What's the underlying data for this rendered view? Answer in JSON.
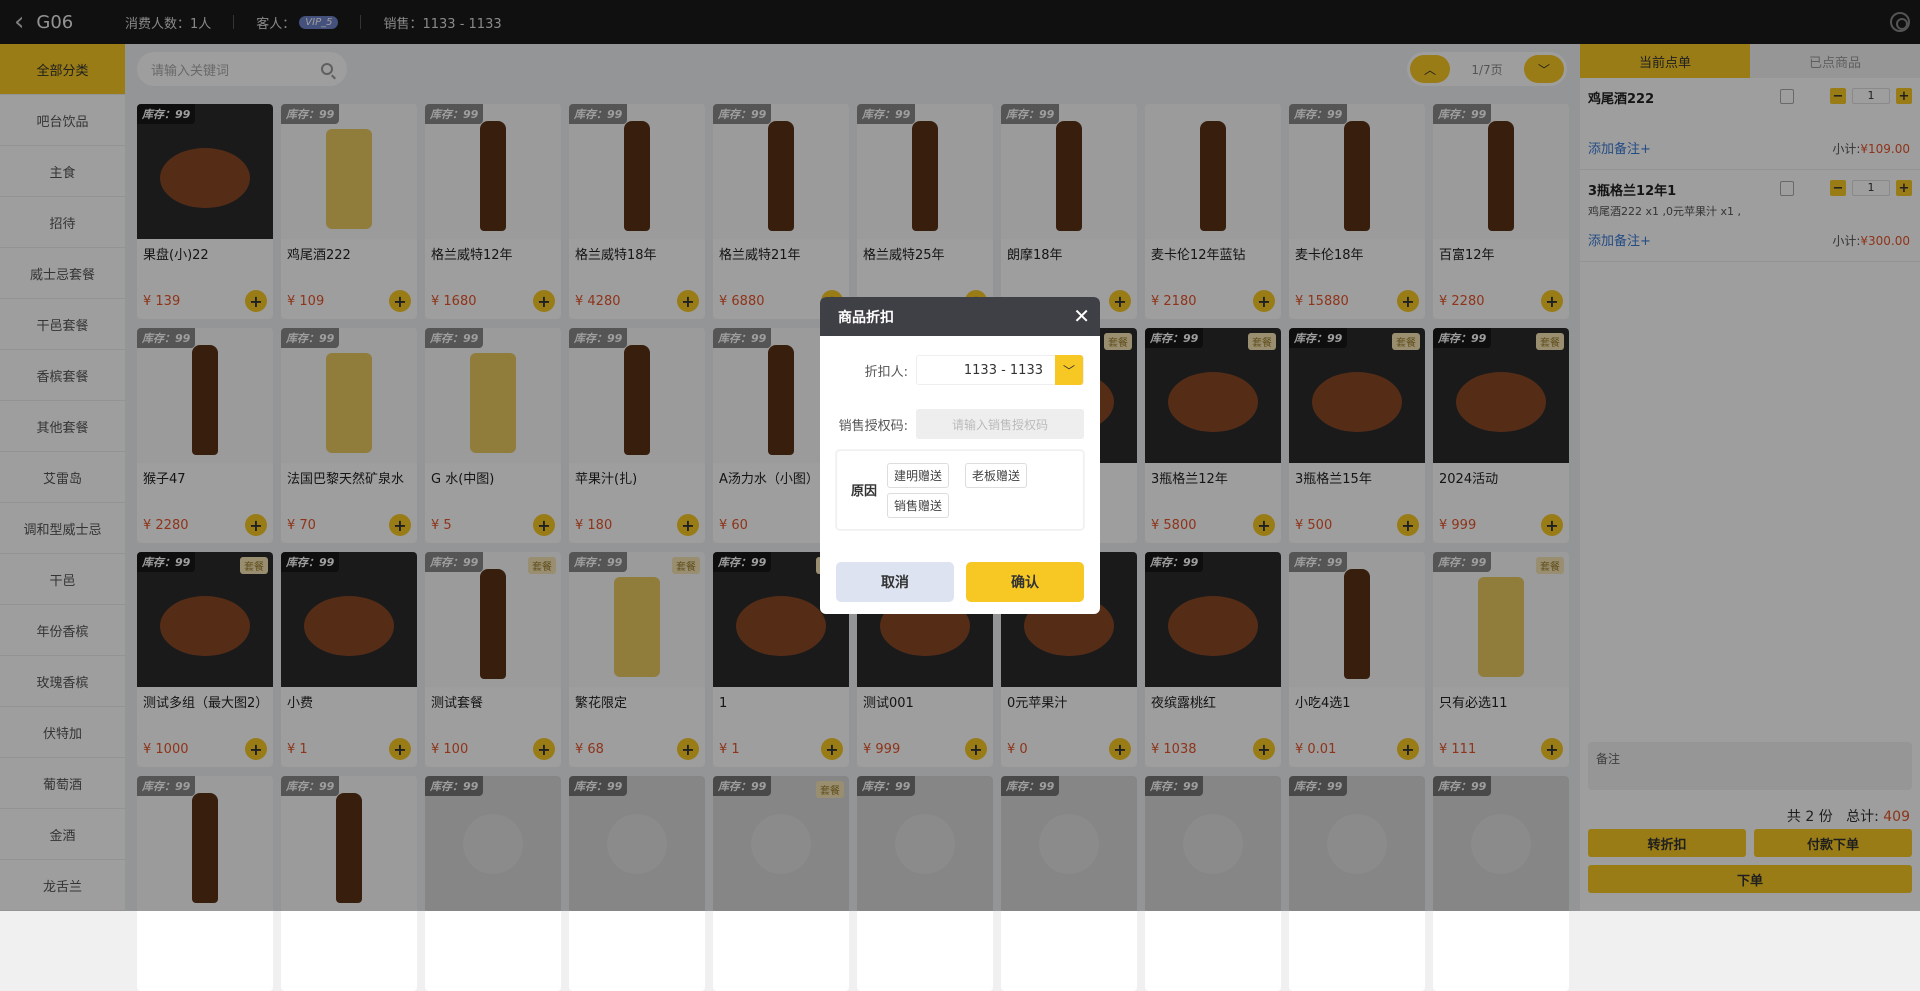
{
  "topbar": {
    "table": "G06",
    "people": "消费人数：1人",
    "guest_label": "客人：",
    "vip": "VIP_5",
    "sales": "销售：1133 - 1133"
  },
  "sidebar": {
    "items": [
      "全部分类",
      "吧台饮品",
      "主食",
      "招待",
      "威士忌套餐",
      "干邑套餐",
      "香槟套餐",
      "其他套餐",
      "艾雷岛",
      "调和型威士忌",
      "干邑",
      "年份香槟",
      "玫瑰香槟",
      "伏特加",
      "葡萄酒",
      "金酒",
      "龙舌兰"
    ]
  },
  "search": {
    "placeholder": "请输入关键词"
  },
  "pager": {
    "page": "1/7页"
  },
  "products": [
    {
      "stock": "库存：99",
      "name": "果盘(小)22",
      "price": "¥ 139",
      "combo": ""
    },
    {
      "stock": "库存：99",
      "name": "鸡尾酒222",
      "price": "¥ 109",
      "combo": ""
    },
    {
      "stock": "库存：99",
      "name": "格兰威特12年",
      "price": "¥ 1680",
      "combo": ""
    },
    {
      "stock": "库存：99",
      "name": "格兰威特18年",
      "price": "¥ 4280",
      "combo": ""
    },
    {
      "stock": "库存：99",
      "name": "格兰威特21年",
      "price": "¥ 6880",
      "combo": ""
    },
    {
      "stock": "库存：99",
      "name": "格兰威特25年",
      "price": "",
      "combo": ""
    },
    {
      "stock": "库存：99",
      "name": "朗摩18年",
      "price": "",
      "combo": ""
    },
    {
      "stock": "",
      "name": "麦卡伦12年蓝钻",
      "price": "¥ 2180",
      "combo": ""
    },
    {
      "stock": "库存：99",
      "name": "麦卡伦18年",
      "price": "¥ 15880",
      "combo": ""
    },
    {
      "stock": "库存：99",
      "name": "百富12年",
      "price": "¥ 2280",
      "combo": ""
    },
    {
      "stock": "库存：99",
      "name": "猴子47",
      "price": "¥ 2280",
      "combo": ""
    },
    {
      "stock": "库存：99",
      "name": "法国巴黎天然矿泉水",
      "price": "¥ 70",
      "combo": ""
    },
    {
      "stock": "库存：99",
      "name": "G 水(中图)",
      "price": "¥ 5",
      "combo": ""
    },
    {
      "stock": "库存：99",
      "name": "苹果汁(扎)",
      "price": "¥ 180",
      "combo": ""
    },
    {
      "stock": "库存：99",
      "name": "A汤力水（小图）",
      "price": "¥ 60",
      "combo": ""
    },
    {
      "stock": "",
      "name": "",
      "price": "",
      "combo": ""
    },
    {
      "stock": "",
      "name": "",
      "price": "",
      "combo": "套餐"
    },
    {
      "stock": "库存：99",
      "name": "3瓶格兰12年",
      "price": "¥ 5800",
      "combo": "套餐"
    },
    {
      "stock": "库存：99",
      "name": "3瓶格兰15年",
      "price": "¥ 500",
      "combo": "套餐"
    },
    {
      "stock": "库存：99",
      "name": "2024活动",
      "price": "¥ 999",
      "combo": "套餐"
    },
    {
      "stock": "库存：99",
      "name": "测试多组（最大图2）",
      "price": "¥ 1000",
      "combo": "套餐"
    },
    {
      "stock": "库存：99",
      "name": "小费",
      "price": "¥ 1",
      "combo": ""
    },
    {
      "stock": "库存：99",
      "name": "测试套餐",
      "price": "¥ 100",
      "combo": "套餐"
    },
    {
      "stock": "库存：99",
      "name": "繁花限定",
      "price": "¥ 68",
      "combo": "套餐"
    },
    {
      "stock": "库存：99",
      "name": "1",
      "price": "¥ 1",
      "combo": "套餐"
    },
    {
      "stock": "",
      "name": "测试001",
      "price": "¥ 999",
      "combo": ""
    },
    {
      "stock": "",
      "name": "0元苹果汁",
      "price": "¥ 0",
      "combo": ""
    },
    {
      "stock": "库存：99",
      "name": "夜缤露桃红",
      "price": "¥ 1038",
      "combo": ""
    },
    {
      "stock": "库存：99",
      "name": "小吃4选1",
      "price": "¥ 0.01",
      "combo": ""
    },
    {
      "stock": "库存：99",
      "name": "只有必选11",
      "price": "¥ 111",
      "combo": "套餐"
    },
    {
      "stock": "库存：99",
      "name": "",
      "price": "",
      "combo": ""
    },
    {
      "stock": "库存：99",
      "name": "",
      "price": "",
      "combo": ""
    },
    {
      "stock": "库存：99",
      "name": "",
      "price": "",
      "combo": ""
    },
    {
      "stock": "库存：99",
      "name": "",
      "price": "",
      "combo": ""
    },
    {
      "stock": "库存：99",
      "name": "",
      "price": "",
      "combo": "套餐"
    },
    {
      "stock": "库存：99",
      "name": "",
      "price": "",
      "combo": ""
    },
    {
      "stock": "库存：99",
      "name": "",
      "price": "",
      "combo": ""
    },
    {
      "stock": "库存：99",
      "name": "",
      "price": "",
      "combo": ""
    },
    {
      "stock": "库存：99",
      "name": "",
      "price": "",
      "combo": ""
    },
    {
      "stock": "库存：99",
      "name": "",
      "price": "",
      "combo": ""
    }
  ],
  "right": {
    "tab_current": "当前点单",
    "tab_done": "已点商品",
    "orders": [
      {
        "name": "鸡尾酒222",
        "desc": "",
        "qty": "1",
        "note": "添加备注+",
        "subtotal_label": "小计:",
        "subtotal": "¥109.00"
      },
      {
        "name": "3瓶格兰12年1",
        "desc": "鸡尾酒222 x1 ,0元苹果汁 x1 ,",
        "qty": "1",
        "note": "添加备注+",
        "subtotal_label": "小计:",
        "subtotal": "¥300.00"
      }
    ],
    "remark": "备注",
    "count": "共 2 份",
    "total_label": "总计:",
    "total": "409",
    "btn_discount": "转折扣",
    "btn_pay": "付款下单",
    "btn_order": "下单"
  },
  "modal": {
    "title": "商品折扣",
    "discounter_label": "折扣人:",
    "discounter_value": "1133 - 1133",
    "auth_label": "销售授权码:",
    "auth_placeholder": "请输入销售授权码",
    "reason_label": "原因",
    "reasons": [
      "建明赠送",
      "老板赠送",
      "销售赠送"
    ],
    "cancel": "取消",
    "confirm": "确认"
  },
  "colors": {
    "accent": "#f7c823",
    "price": "#e4552a",
    "link": "#3a7bd5"
  }
}
